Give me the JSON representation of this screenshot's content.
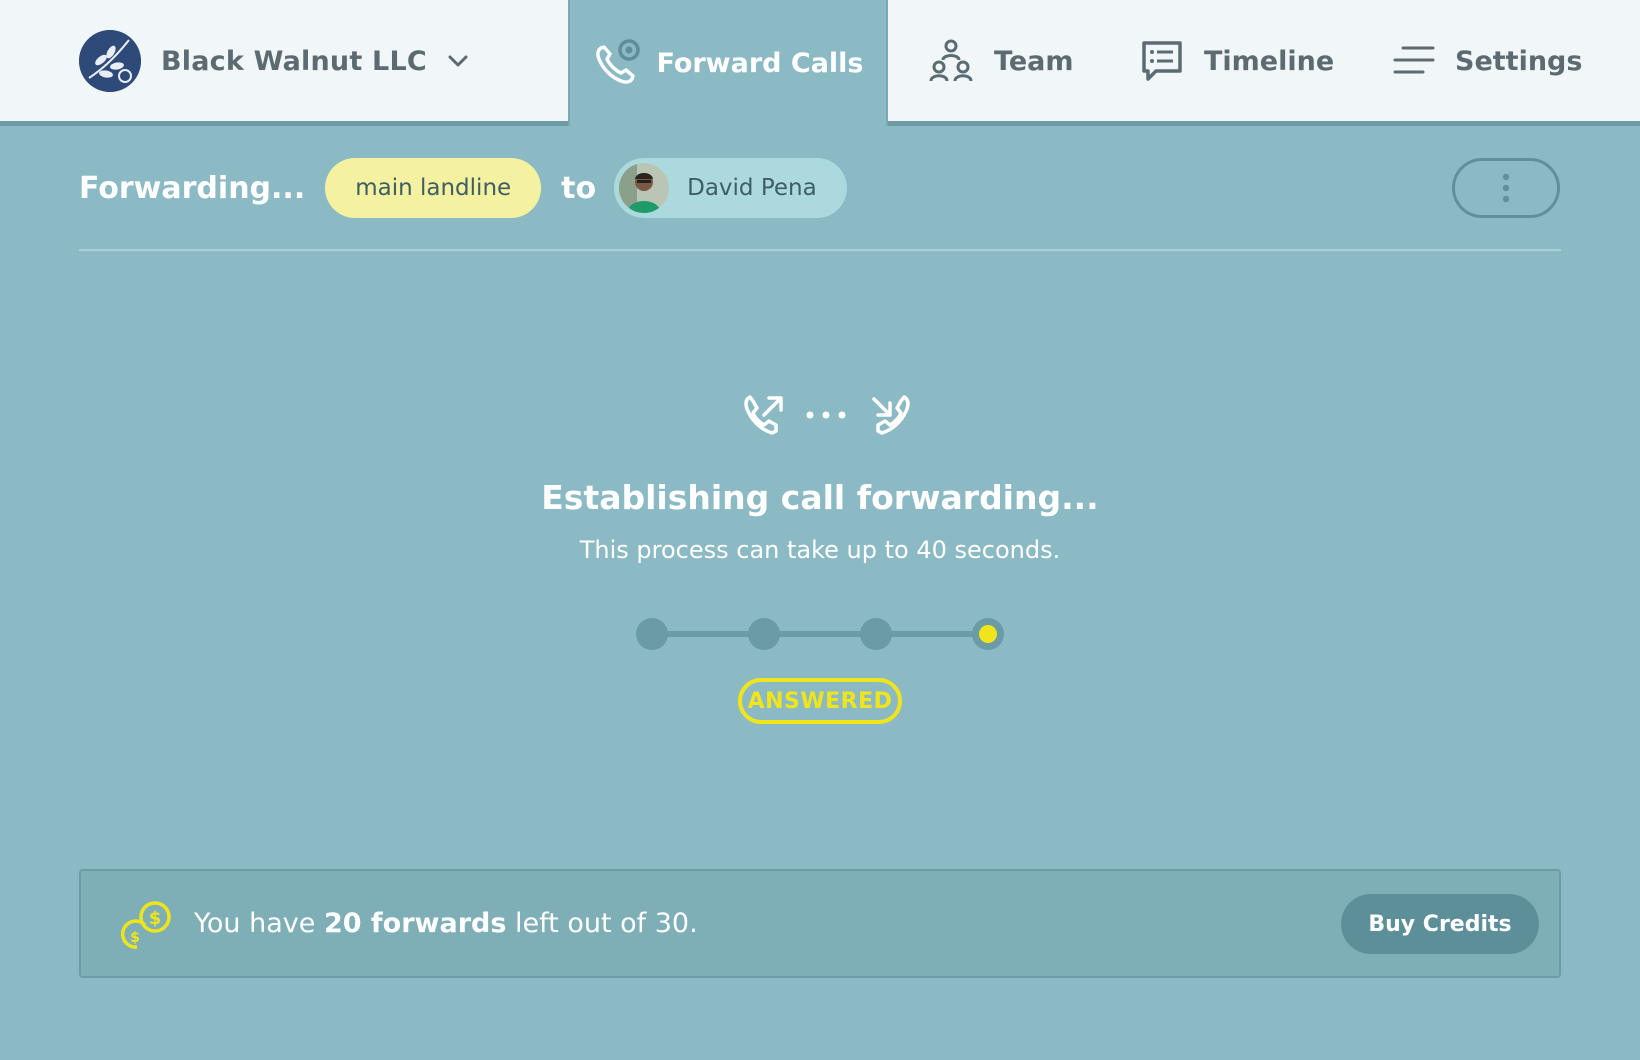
{
  "header": {
    "company": "Black Walnut LLC",
    "tabs": [
      {
        "label": "Forward Calls",
        "icon": "phone-forward-icon",
        "active": true
      },
      {
        "label": "Team",
        "icon": "team-icon"
      },
      {
        "label": "Timeline",
        "icon": "chat-list-icon"
      },
      {
        "label": "Settings",
        "icon": "menu-lines-icon"
      }
    ]
  },
  "forwarding": {
    "title": "Forwarding...",
    "source": "main landline",
    "to_word": "to",
    "target_name": "David Pena"
  },
  "status": {
    "title": "Establishing call forwarding...",
    "subtitle": "This process can take up to 40 seconds.",
    "steps_total": 4,
    "steps_current": 4,
    "badge": "ANSWERED"
  },
  "credits": {
    "prefix": "You have ",
    "bold": "20 forwards",
    "suffix": " left out of 30.",
    "button": "Buy Credits"
  },
  "colors": {
    "background": "#8cbac4",
    "topbar": "#f1f6f8",
    "accent_yellow": "#f0e51a",
    "source_pill": "#f4f2a1",
    "person_pill": "#acd9de",
    "button": "#5c8f98",
    "logo": "#2e4a78"
  }
}
